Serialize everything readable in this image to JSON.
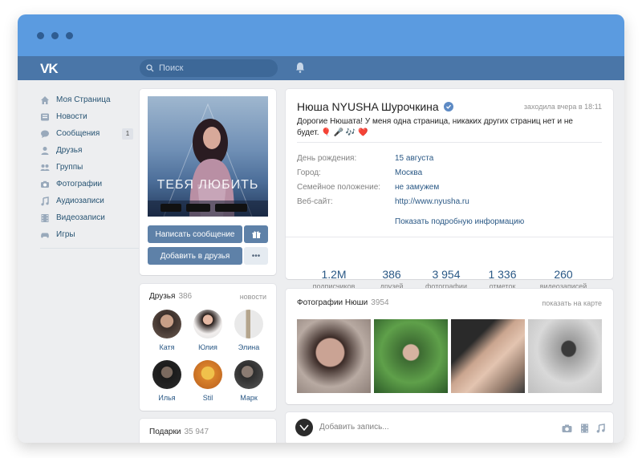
{
  "search": {
    "placeholder": "Поиск"
  },
  "sidebar": {
    "items": [
      {
        "label": "Моя Страница",
        "icon": "home-icon"
      },
      {
        "label": "Новости",
        "icon": "news-icon"
      },
      {
        "label": "Сообщения",
        "icon": "messages-icon",
        "badge": "1"
      },
      {
        "label": "Друзья",
        "icon": "friends-icon"
      },
      {
        "label": "Группы",
        "icon": "groups-icon"
      },
      {
        "label": "Фотографии",
        "icon": "camera-icon"
      },
      {
        "label": "Аудиозаписи",
        "icon": "music-icon"
      },
      {
        "label": "Видеозаписи",
        "icon": "video-icon"
      },
      {
        "label": "Игры",
        "icon": "gamepad-icon"
      }
    ]
  },
  "profile_card": {
    "cover_text": "ТЕБЯ ЛЮБИТЬ",
    "send_message": "Написать сообщение",
    "add_friend": "Добавить в друзья",
    "more": "•••"
  },
  "friends": {
    "title": "Друзья",
    "count": "386",
    "news_link": "новости",
    "list": [
      {
        "name": "Катя"
      },
      {
        "name": "Юлия"
      },
      {
        "name": "Элина"
      },
      {
        "name": "Илья"
      },
      {
        "name": "Stil"
      },
      {
        "name": "Марк"
      }
    ]
  },
  "gifts": {
    "title": "Подарки",
    "count": "35 947"
  },
  "profile": {
    "name": "Нюша NYUSHA Шурочкина",
    "last_seen": "заходила вчера в 18:11",
    "status": "Дорогие Нюшата! У меня одна страница, никаких других страниц нет и не будет. 🎈 🎤 🎶 ❤️",
    "info": [
      {
        "label": "День рождения:",
        "value": "15 августа"
      },
      {
        "label": "Город:",
        "value": "Москва"
      },
      {
        "label": "Семейное положение:",
        "value": "не замужем"
      },
      {
        "label": "Веб-сайт:",
        "value": "http://www.nyusha.ru"
      }
    ],
    "more_info": "Показать подробную информацию",
    "stats": [
      {
        "num": "1.2M",
        "label": "подписчиков"
      },
      {
        "num": "386",
        "label": "друзей"
      },
      {
        "num": "3 954",
        "label": "фотографии"
      },
      {
        "num": "1 336",
        "label": "отметок"
      },
      {
        "num": "260",
        "label": "видеозаписей"
      }
    ]
  },
  "photos": {
    "title": "Фотографии Нюши",
    "count": "3954",
    "map_link": "показать на карте"
  },
  "post": {
    "placeholder": "Добавить запись..."
  },
  "colors": {
    "header": "#4a76a8",
    "titlebar": "#5b9be0",
    "accent": "#5e81a8",
    "link": "#2a5885"
  }
}
